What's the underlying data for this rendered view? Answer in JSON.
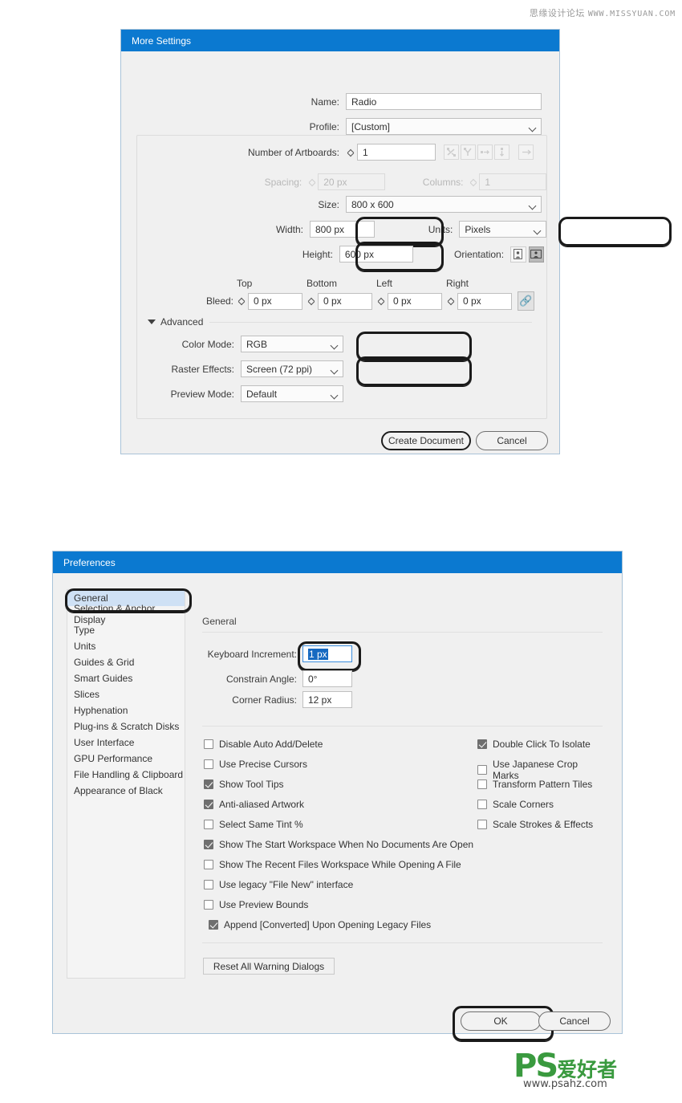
{
  "watermarks": {
    "top_cn": "思缘设计论坛",
    "top_url": "WWW.MISSYUAN.COM",
    "logo_ps": "PS",
    "logo_cn": "爱好者",
    "logo_url": "www.psahz.com"
  },
  "colors": {
    "titlebar": "#0b79d0",
    "dialog_bg": "#f0f0f0",
    "selection_blue": "#1669c1",
    "list_selected": "#cfe1f5",
    "annotation_ring": "#1a1a1a",
    "logo_green": "#3a9a3f"
  },
  "more_settings": {
    "title": "More Settings",
    "name": {
      "label": "Name:",
      "value": "Radio"
    },
    "profile": {
      "label": "Profile:",
      "value": "[Custom]"
    },
    "artboards": {
      "label": "Number of Artboards:",
      "value": "1"
    },
    "arrange_icons": [
      "grid-by-row-icon",
      "grid-by-column-icon",
      "arrange-by-row-icon",
      "arrange-by-column-icon"
    ],
    "arrange_direction_icon": "arrow-right-icon",
    "spacing": {
      "label": "Spacing:",
      "value": "20 px",
      "disabled": true
    },
    "columns": {
      "label": "Columns:",
      "value": "1",
      "disabled": true
    },
    "size": {
      "label": "Size:",
      "value": "800 x 600"
    },
    "width": {
      "label": "Width:",
      "value": "800 px",
      "highlighted": true
    },
    "height": {
      "label": "Height:",
      "value": "600 px",
      "highlighted": true
    },
    "units": {
      "label": "Units:",
      "value": "Pixels",
      "highlighted": true
    },
    "orientation": {
      "label": "Orientation:",
      "options": [
        "portrait-icon",
        "landscape-icon"
      ],
      "selected": "landscape-icon"
    },
    "bleed": {
      "label": "Bleed:",
      "columns": [
        "Top",
        "Bottom",
        "Left",
        "Right"
      ],
      "values": [
        "0 px",
        "0 px",
        "0 px",
        "0 px"
      ],
      "link_icon": "chain-link-icon"
    },
    "advanced": {
      "label": "Advanced",
      "disclosure_icon": "triangle-down-icon",
      "color_mode": {
        "label": "Color Mode:",
        "value": "RGB",
        "highlighted": true
      },
      "raster_effects": {
        "label": "Raster Effects:",
        "value": "Screen (72 ppi)",
        "highlighted": true
      },
      "preview_mode": {
        "label": "Preview Mode:",
        "value": "Default"
      }
    },
    "buttons": {
      "create": "Create Document",
      "cancel": "Cancel"
    }
  },
  "preferences": {
    "title": "Preferences",
    "sidebar": [
      {
        "label": "General",
        "selected": true,
        "highlighted": true
      },
      {
        "label": "Selection & Anchor Display"
      },
      {
        "label": "Type"
      },
      {
        "label": "Units"
      },
      {
        "label": "Guides & Grid"
      },
      {
        "label": "Smart Guides"
      },
      {
        "label": "Slices"
      },
      {
        "label": "Hyphenation"
      },
      {
        "label": "Plug-ins & Scratch Disks"
      },
      {
        "label": "User Interface"
      },
      {
        "label": "GPU Performance"
      },
      {
        "label": "File Handling & Clipboard"
      },
      {
        "label": "Appearance of Black"
      }
    ],
    "section_title": "General",
    "fields": [
      {
        "label": "Keyboard Increment:",
        "value": "1 px",
        "selected_text": true,
        "highlighted": true
      },
      {
        "label": "Constrain Angle:",
        "value": "0°"
      },
      {
        "label": "Corner Radius:",
        "value": "12 px"
      }
    ],
    "checkboxes_left": [
      {
        "label": "Disable Auto Add/Delete",
        "checked": false
      },
      {
        "label": "Use Precise Cursors",
        "checked": false
      },
      {
        "label": "Show Tool Tips",
        "checked": true
      },
      {
        "label": "Anti-aliased Artwork",
        "checked": true
      },
      {
        "label": "Select Same Tint %",
        "checked": false
      },
      {
        "label": "Show The Start Workspace When No Documents Are Open",
        "checked": true
      },
      {
        "label": "Show The Recent Files Workspace While Opening A File",
        "checked": false
      },
      {
        "label": "Use legacy \"File New\" interface",
        "checked": false
      },
      {
        "label": "Use Preview Bounds",
        "checked": false
      },
      {
        "label": "Append [Converted] Upon Opening Legacy Files",
        "checked": true
      }
    ],
    "checkboxes_right": [
      {
        "label": "Double Click To Isolate",
        "checked": true
      },
      {
        "label": "Use Japanese Crop Marks",
        "checked": false
      },
      {
        "label": "Transform Pattern Tiles",
        "checked": false
      },
      {
        "label": "Scale Corners",
        "checked": false
      },
      {
        "label": "Scale Strokes & Effects",
        "checked": false
      }
    ],
    "reset_button": "Reset All Warning Dialogs",
    "buttons": {
      "ok": "OK",
      "cancel": "Cancel",
      "ok_highlighted": true
    }
  }
}
